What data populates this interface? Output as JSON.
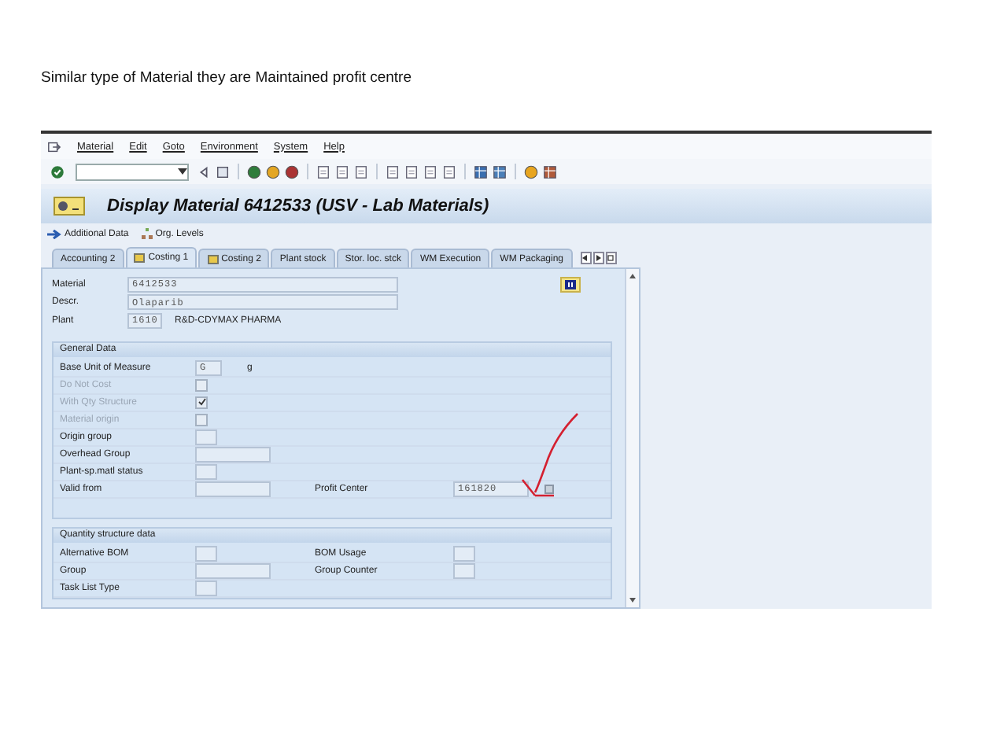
{
  "caption": "Similar type of Material they are Maintained  profit centre",
  "menu": [
    "Material",
    "Edit",
    "Goto",
    "Environment",
    "System",
    "Help"
  ],
  "title": "Display Material 6412533 (USV - Lab Materials)",
  "app_toolbar": [
    "Additional Data",
    "Org. Levels"
  ],
  "tabs": [
    {
      "label": "Accounting 2",
      "selected": false,
      "icon": false
    },
    {
      "label": "Costing 1",
      "selected": true,
      "icon": true
    },
    {
      "label": "Costing 2",
      "selected": false,
      "icon": true
    },
    {
      "label": "Plant stock",
      "selected": false,
      "icon": false
    },
    {
      "label": "Stor. loc. stck",
      "selected": false,
      "icon": false
    },
    {
      "label": "WM Execution",
      "selected": false,
      "icon": false
    },
    {
      "label": "WM Packaging",
      "selected": false,
      "icon": false
    }
  ],
  "header": [
    {
      "label": "Material",
      "value": "6412533",
      "kind": "longfield"
    },
    {
      "label": "Descr.",
      "value": "Olaparib",
      "kind": "longfield"
    },
    {
      "label": "Plant",
      "value": "1610",
      "kind": "shortfield",
      "note": "R&D-CDYMAX PHARMA"
    }
  ],
  "sections": [
    {
      "title": "General Data",
      "rows": [
        {
          "label": "Base Unit of Measure",
          "kind": "shortfield",
          "value": "G",
          "unit": "g",
          "disabled": false
        },
        {
          "label": "Do Not Cost",
          "kind": "checkbox",
          "checked": false,
          "disabled": true
        },
        {
          "label": "With Qty Structure",
          "kind": "checkbox",
          "checked": true,
          "disabled": true
        },
        {
          "label": "Material origin",
          "kind": "checkbox",
          "checked": false,
          "disabled": true
        },
        {
          "label": "Origin group",
          "kind": "shortfield",
          "disabled": false
        },
        {
          "label": "Overhead Group",
          "kind": "longfield",
          "disabled": false
        },
        {
          "label": "Plant-sp.matl status",
          "kind": "shortfield",
          "disabled": false
        },
        {
          "label": "Valid from",
          "kind": "longfield",
          "disabled": false,
          "extra": {
            "label": "Profit Center",
            "kind": "longfield",
            "value": "161820"
          }
        }
      ]
    },
    {
      "title": "Quantity structure data",
      "rows": [
        {
          "label": "Alternative BOM",
          "kind": "shortfield",
          "disabled": false,
          "extra": {
            "label": "BOM Usage",
            "kind": "shortfield"
          }
        },
        {
          "label": "Group",
          "kind": "longfield",
          "disabled": false,
          "extra": {
            "label": "Group Counter",
            "kind": "shortfield"
          }
        },
        {
          "label": "Task List Type",
          "kind": "shortfield",
          "disabled": false
        }
      ]
    }
  ]
}
